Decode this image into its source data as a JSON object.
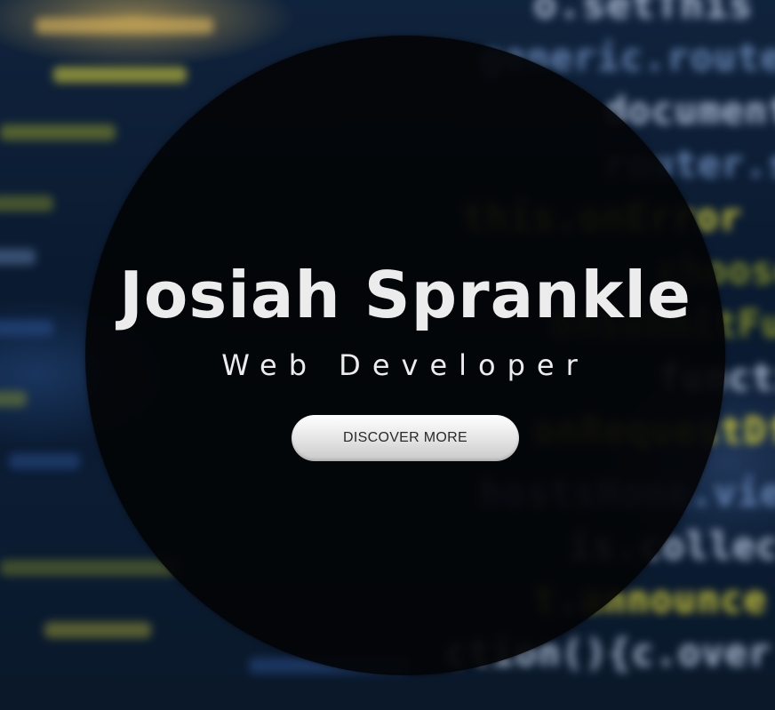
{
  "hero": {
    "name": "Josiah Sprankle",
    "role": "Web Developer",
    "cta_label": "DISCOVER MORE"
  },
  "background": {
    "code_fragments": [
      "o.setThis",
      "generic.router.s",
      "document.",
      "router.se",
      "this.onError",
      "chooseTrig",
      "onSubmitFunc",
      "function",
      "onRequestDf",
      "hostsHome.view.",
      "is.collectio",
      "t.announce",
      "ction(){c.over"
    ]
  },
  "colors": {
    "circle": "#030406",
    "text": "#ececec",
    "button_top": "#ffffff",
    "button_bottom": "#c9c9c9",
    "code_yellow": "#d9d23a",
    "code_blue": "#6f8fbf"
  }
}
